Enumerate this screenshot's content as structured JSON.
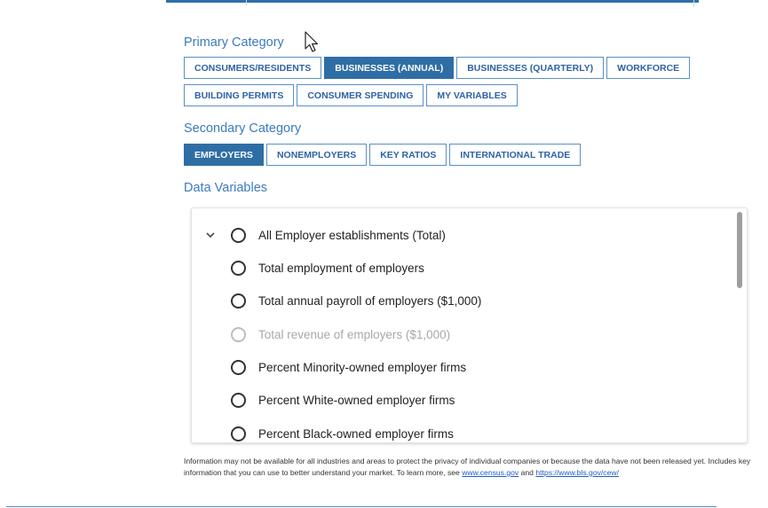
{
  "primary": {
    "heading": "Primary Category",
    "buttons": [
      {
        "label": "CONSUMERS/RESIDENTS",
        "active": false
      },
      {
        "label": "BUSINESSES (ANNUAL)",
        "active": true
      },
      {
        "label": "BUSINESSES (QUARTERLY)",
        "active": false
      },
      {
        "label": "WORKFORCE",
        "active": false
      },
      {
        "label": "BUILDING PERMITS",
        "active": false
      },
      {
        "label": "CONSUMER SPENDING",
        "active": false
      },
      {
        "label": "MY VARIABLES",
        "active": false
      }
    ]
  },
  "secondary": {
    "heading": "Secondary Category",
    "buttons": [
      {
        "label": "EMPLOYERS",
        "active": true
      },
      {
        "label": "NONEMPLOYERS",
        "active": false
      },
      {
        "label": "KEY RATIOS",
        "active": false
      },
      {
        "label": "INTERNATIONAL TRADE",
        "active": false
      }
    ]
  },
  "data_variables": {
    "heading": "Data Variables",
    "items": [
      {
        "label": "All Employer establishments (Total)",
        "disabled": false,
        "expandable": true
      },
      {
        "label": "Total employment of employers",
        "disabled": false
      },
      {
        "label": "Total annual payroll of employers ($1,000)",
        "disabled": false
      },
      {
        "label": "Total revenue of employers ($1,000)",
        "disabled": true
      },
      {
        "label": "Percent Minority-owned employer firms",
        "disabled": false
      },
      {
        "label": "Percent White-owned employer firms",
        "disabled": false
      },
      {
        "label": "Percent Black-owned employer firms",
        "disabled": false
      }
    ]
  },
  "footer": {
    "text_before": "Information may not be available for all industries and areas to protect the privacy of individual companies or because the data have not been released yet. Includes key information that you can use to better understand your market. To learn more, see ",
    "link1": "www.census.gov",
    "text_middle": " and ",
    "link2": "https://www.bls.gov/cew/"
  },
  "colors": {
    "accent": "#2f6ea5",
    "heading": "#3b7bbf",
    "disabled": "#a8a8a8"
  }
}
